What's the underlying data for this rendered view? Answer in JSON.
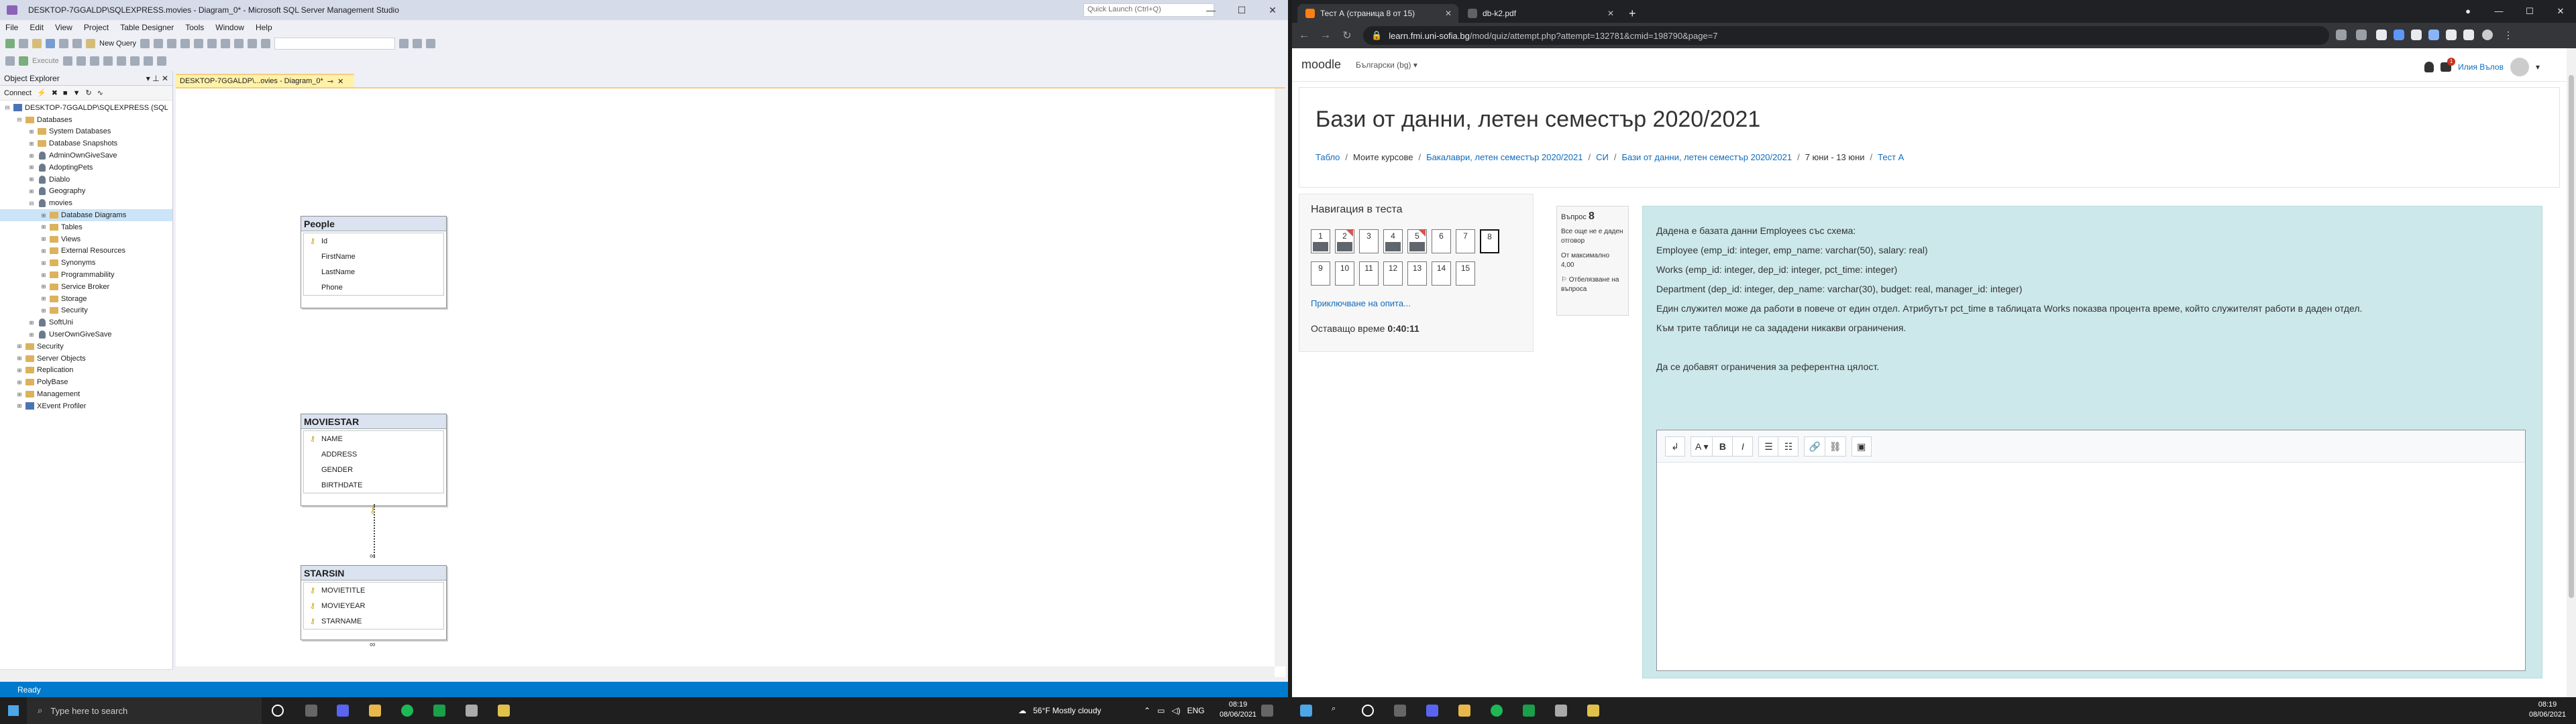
{
  "ssms": {
    "title": "DESKTOP-7GGALDP\\SQLEXPRESS.movies - Diagram_0* - Microsoft SQL Server Management Studio",
    "quick_launch_placeholder": "Quick Launch (Ctrl+Q)",
    "menu": [
      "File",
      "Edit",
      "View",
      "Project",
      "Table Designer",
      "Tools",
      "Window",
      "Help"
    ],
    "toolbar": {
      "new_query": "New Query",
      "execute": "Execute"
    },
    "object_explorer": {
      "title": "Object Explorer",
      "connect": "Connect",
      "nodes": [
        {
          "label": "DESKTOP-7GGALDP\\SQLEXPRESS (SQL",
          "indent": 0,
          "exp": "⊟",
          "type": "server"
        },
        {
          "label": "Databases",
          "indent": 1,
          "exp": "⊟",
          "type": "folder"
        },
        {
          "label": "System Databases",
          "indent": 2,
          "exp": "⊞",
          "type": "folder"
        },
        {
          "label": "Database Snapshots",
          "indent": 2,
          "exp": "⊞",
          "type": "folder"
        },
        {
          "label": "AdminOwnGiveSave",
          "indent": 2,
          "exp": "⊞",
          "type": "db"
        },
        {
          "label": "AdoptingPets",
          "indent": 2,
          "exp": "⊞",
          "type": "db"
        },
        {
          "label": "Diablo",
          "indent": 2,
          "exp": "⊞",
          "type": "db"
        },
        {
          "label": "Geography",
          "indent": 2,
          "exp": "⊞",
          "type": "db"
        },
        {
          "label": "movies",
          "indent": 2,
          "exp": "⊟",
          "type": "db"
        },
        {
          "label": "Database Diagrams",
          "indent": 3,
          "exp": "⊞",
          "type": "folder",
          "selected": true
        },
        {
          "label": "Tables",
          "indent": 3,
          "exp": "⊞",
          "type": "folder"
        },
        {
          "label": "Views",
          "indent": 3,
          "exp": "⊞",
          "type": "folder"
        },
        {
          "label": "External Resources",
          "indent": 3,
          "exp": "⊞",
          "type": "folder"
        },
        {
          "label": "Synonyms",
          "indent": 3,
          "exp": "⊞",
          "type": "folder"
        },
        {
          "label": "Programmability",
          "indent": 3,
          "exp": "⊞",
          "type": "folder"
        },
        {
          "label": "Service Broker",
          "indent": 3,
          "exp": "⊞",
          "type": "folder"
        },
        {
          "label": "Storage",
          "indent": 3,
          "exp": "⊞",
          "type": "folder"
        },
        {
          "label": "Security",
          "indent": 3,
          "exp": "⊞",
          "type": "folder"
        },
        {
          "label": "SoftUni",
          "indent": 2,
          "exp": "⊞",
          "type": "db"
        },
        {
          "label": "UserOwnGiveSave",
          "indent": 2,
          "exp": "⊞",
          "type": "db"
        },
        {
          "label": "Security",
          "indent": 1,
          "exp": "⊞",
          "type": "folder"
        },
        {
          "label": "Server Objects",
          "indent": 1,
          "exp": "⊞",
          "type": "folder"
        },
        {
          "label": "Replication",
          "indent": 1,
          "exp": "⊞",
          "type": "folder"
        },
        {
          "label": "PolyBase",
          "indent": 1,
          "exp": "⊞",
          "type": "folder"
        },
        {
          "label": "Management",
          "indent": 1,
          "exp": "⊞",
          "type": "folder"
        },
        {
          "label": "XEvent Profiler",
          "indent": 1,
          "exp": "⊞",
          "type": "special"
        }
      ]
    },
    "doc_tab": "DESKTOP-7GGALDP\\...ovies - Diagram_0*",
    "tables": {
      "people": {
        "name": "People",
        "cols": [
          "Id",
          "FirstName",
          "LastName",
          "Phone"
        ],
        "keys": [
          true,
          false,
          false,
          false
        ]
      },
      "moviestar": {
        "name": "MOVIESTAR",
        "cols": [
          "NAME",
          "ADDRESS",
          "GENDER",
          "BIRTHDATE"
        ],
        "keys": [
          true,
          false,
          false,
          false
        ]
      },
      "starsin": {
        "name": "STARSIN",
        "cols": [
          "MOVIETITLE",
          "MOVIEYEAR",
          "STARNAME"
        ],
        "keys": [
          true,
          true,
          true
        ]
      }
    },
    "status": "Ready"
  },
  "chrome": {
    "tabs": [
      {
        "label": "Тест А (страница 8 от 15)",
        "active": true
      },
      {
        "label": "db-k2.pdf",
        "active": false
      }
    ],
    "url_host": "learn.fmi.uni-sofia.bg",
    "url_path": "/mod/quiz/attempt.php?attempt=132781&cmid=198790&page=7"
  },
  "moodle": {
    "logo": "moodle",
    "language": "Български (bg)",
    "user_name": "Илия Вълов",
    "messages_badge": "1",
    "course_title": "Бази от данни, летен семестър 2020/2021",
    "breadcrumbs": [
      {
        "label": "Табло",
        "link": true
      },
      {
        "label": "Моите курсове",
        "link": false
      },
      {
        "label": "Бакалаври, летен семестър 2020/2021",
        "link": true
      },
      {
        "label": "СИ",
        "link": true
      },
      {
        "label": "Бази от данни, летен семестър 2020/2021",
        "link": true
      },
      {
        "label": "7 юни - 13 юни",
        "link": false
      },
      {
        "label": "Тест А",
        "link": true
      }
    ],
    "nav": {
      "title": "Навигация в теста",
      "questions": [
        {
          "n": "1",
          "answered": true,
          "flag": false
        },
        {
          "n": "2",
          "answered": true,
          "flag": true
        },
        {
          "n": "3",
          "answered": false,
          "flag": false
        },
        {
          "n": "4",
          "answered": true,
          "flag": false
        },
        {
          "n": "5",
          "answered": true,
          "flag": true
        },
        {
          "n": "6",
          "answered": false,
          "flag": false
        },
        {
          "n": "7",
          "answered": false,
          "flag": false
        },
        {
          "n": "8",
          "answered": false,
          "flag": false,
          "current": true
        },
        {
          "n": "9",
          "answered": false,
          "flag": false
        },
        {
          "n": "10",
          "answered": false,
          "flag": false
        },
        {
          "n": "11",
          "answered": false,
          "flag": false
        },
        {
          "n": "12",
          "answered": false,
          "flag": false
        },
        {
          "n": "13",
          "answered": false,
          "flag": false
        },
        {
          "n": "14",
          "answered": false,
          "flag": false
        },
        {
          "n": "15",
          "answered": false,
          "flag": false
        }
      ],
      "finish": "Приключване на опита...",
      "time_label": "Оставащо време",
      "time_value": "0:40:11"
    },
    "info": {
      "q_label": "Въпрос",
      "q_number": "8",
      "status": "Все още не е даден отговор",
      "marks": "От максимално 4,00",
      "flag": "Отбелязване на въпроса"
    },
    "question_lines": [
      "Дадена е базата данни Employees със схема:",
      "Employee (emp_id: integer, emp_name: varchar(50), salary: real)",
      "Works (emp_id: integer, dep_id: integer, pct_time: integer)",
      "Department (dep_id: integer, dep_name: varchar(30), budget: real, manager_id: integer)",
      "Един служител може да работи в повече от един отдел. Атрибутът pct_time в таблицата Works показва процента време, който служителят работи в даден отдел.",
      "Към трите таблици не са зададени никакви ограничения.",
      "",
      "Да се добавят ограничения за референтна цялост."
    ],
    "editor_tools": [
      "↲",
      "A ▾",
      "B",
      "I",
      "☰",
      "☷",
      "🔗",
      "⛓",
      "▣"
    ]
  },
  "taskbar": {
    "search_placeholder": "Type here to search",
    "weather": "56°F  Mostly cloudy",
    "lang": "ENG",
    "time_left": "08:19",
    "date_left": "08/06/2021",
    "time_right": "08:19",
    "date_right": "08/06/2021"
  }
}
